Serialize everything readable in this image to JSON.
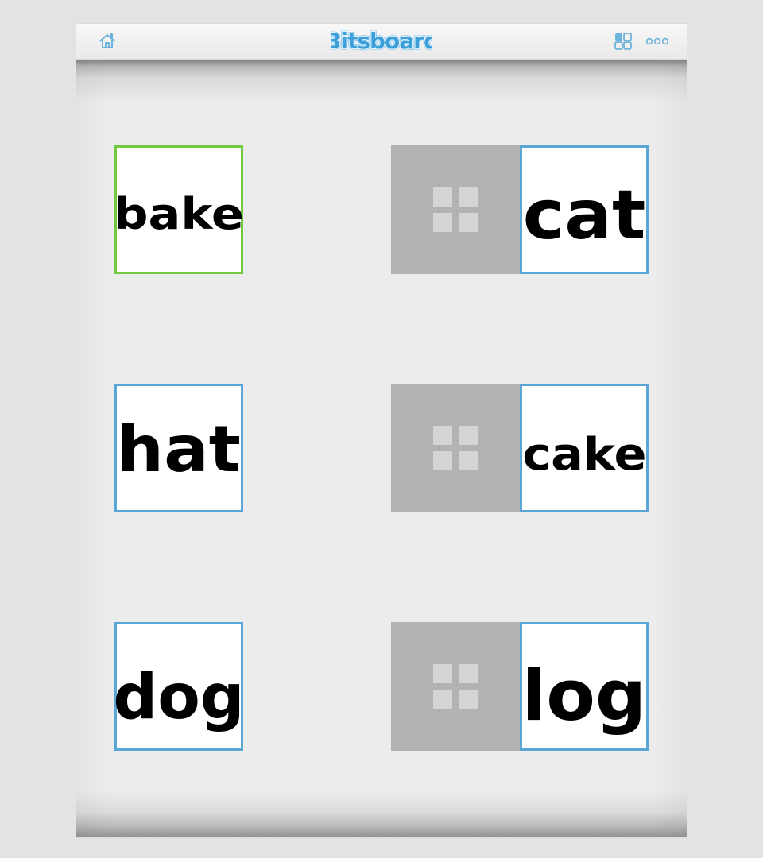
{
  "app": {
    "name": "Bitsboard",
    "colors": {
      "accent": "#5aa7d6",
      "success": "#72c83f",
      "panel": "#b2b2b2",
      "background": "#ececec"
    }
  },
  "toolbar": {
    "home_icon": "home-icon",
    "logo_text": "Bitsboard",
    "layout_icon": "layout-icon",
    "more_icon": "more-icon"
  },
  "board": {
    "left_words": [
      {
        "label": "bake",
        "status": "correct"
      },
      {
        "label": "hat",
        "status": "default"
      },
      {
        "label": "dog",
        "status": "default"
      }
    ],
    "right_words": [
      {
        "label": "cat",
        "status": "default"
      },
      {
        "label": "cake",
        "status": "default"
      },
      {
        "label": "log",
        "status": "default"
      }
    ],
    "slot_icons": [
      "grid-icon",
      "grid-icon",
      "grid-icon"
    ]
  }
}
